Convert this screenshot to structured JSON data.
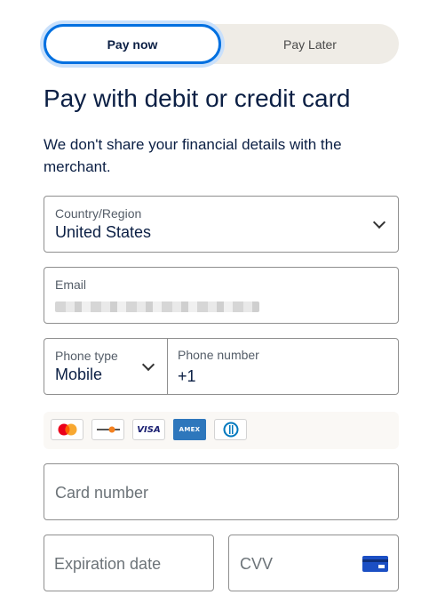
{
  "tabs": {
    "active": "Pay now",
    "inactive": "Pay Later"
  },
  "heading": "Pay with debit or credit card",
  "subtext": "We don't share your financial details with the merchant.",
  "country": {
    "label": "Country/Region",
    "value": "United States"
  },
  "email": {
    "label": "Email",
    "value": ""
  },
  "phone_type": {
    "label": "Phone type",
    "value": "Mobile"
  },
  "phone_number": {
    "label": "Phone number",
    "value": "+1"
  },
  "card_logos": [
    "mastercard",
    "discover",
    "visa",
    "amex",
    "diners-club"
  ],
  "card_logo_text": {
    "visa": "VISA",
    "amex": "AMEX"
  },
  "card_number": {
    "placeholder": "Card number"
  },
  "expiration": {
    "placeholder": "Expiration date"
  },
  "cvv": {
    "placeholder": "CVV"
  },
  "colors": {
    "accent": "#0070e0",
    "text": "#0b1f44",
    "tab_bg": "#efece6"
  }
}
